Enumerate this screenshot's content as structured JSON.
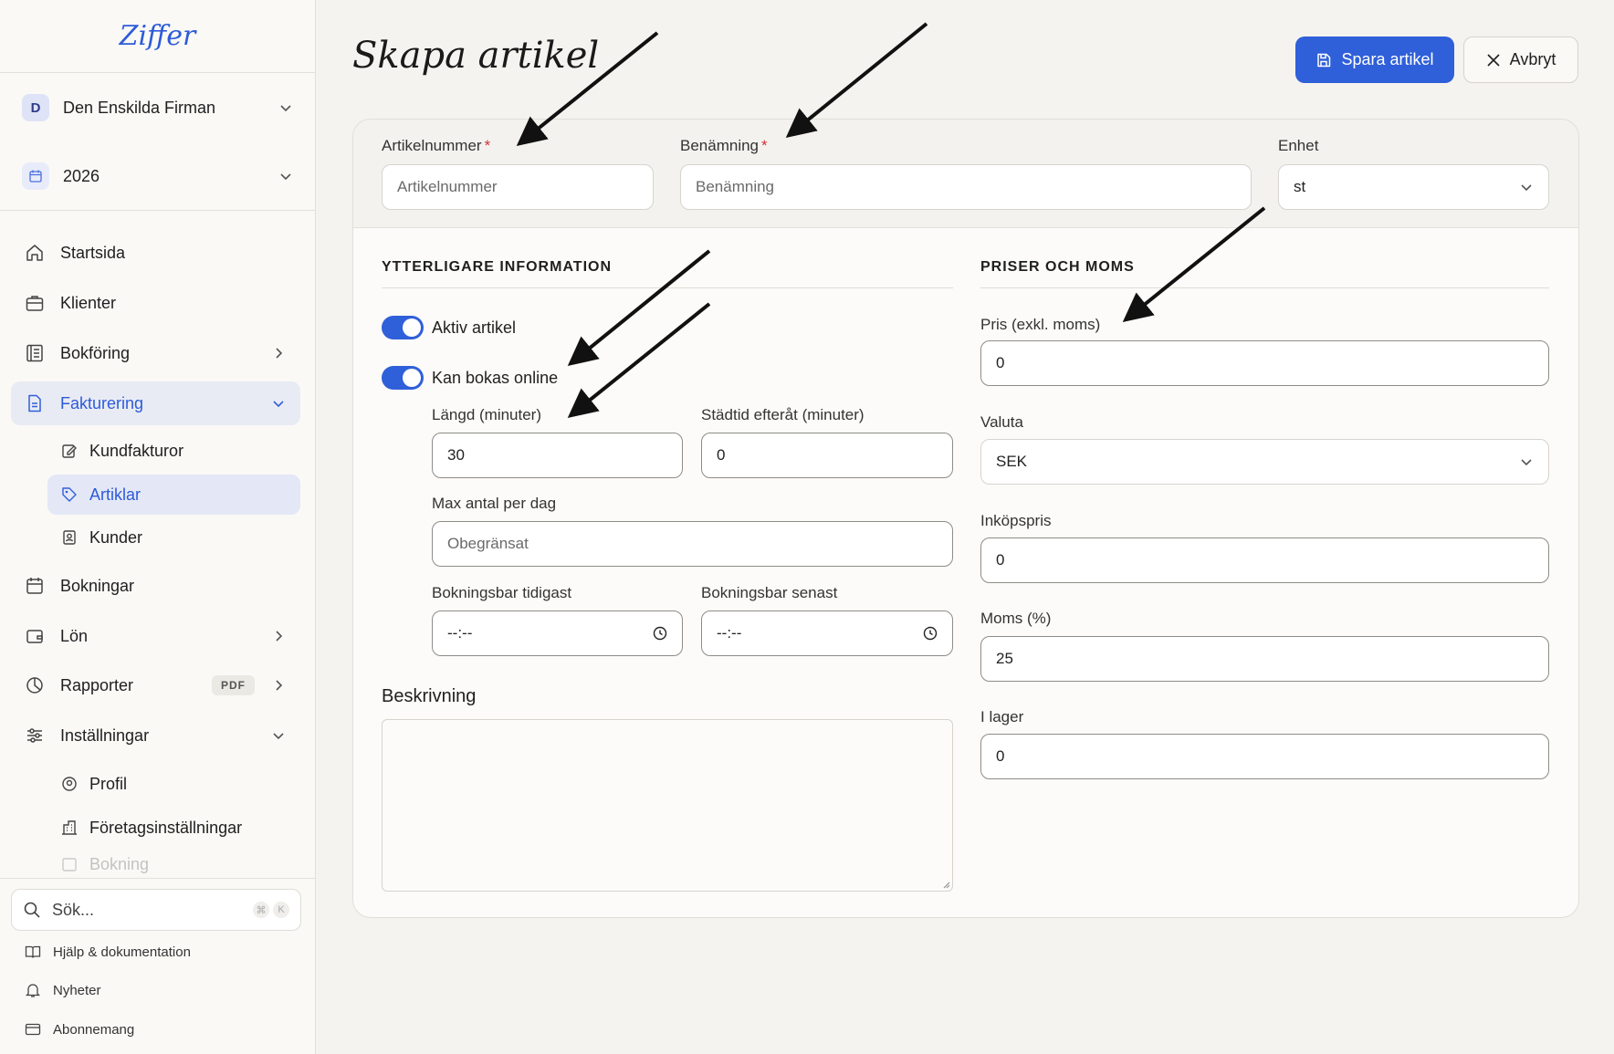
{
  "app": {
    "logo": "Ziffer"
  },
  "sidebar": {
    "company": {
      "initial": "D",
      "name": "Den Enskilda Firman"
    },
    "year": "2026",
    "items": [
      {
        "label": "Startsida"
      },
      {
        "label": "Klienter"
      },
      {
        "label": "Bokföring"
      },
      {
        "label": "Fakturering"
      },
      {
        "label": "Kundfakturor"
      },
      {
        "label": "Artiklar"
      },
      {
        "label": "Kunder"
      },
      {
        "label": "Bokningar"
      },
      {
        "label": "Lön"
      },
      {
        "label": "Rapporter",
        "badge": "PDF"
      },
      {
        "label": "Inställningar"
      },
      {
        "label": "Profil"
      },
      {
        "label": "Företagsinställningar"
      },
      {
        "label": "Bokning"
      }
    ],
    "search": {
      "placeholder": "Sök...",
      "kbd1": "⌘",
      "kbd2": "K"
    },
    "footer": [
      {
        "label": "Hjälp & dokumentation"
      },
      {
        "label": "Nyheter"
      },
      {
        "label": "Abonnemang"
      }
    ]
  },
  "page": {
    "title": "Skapa artikel",
    "save_label": "Spara artikel",
    "cancel_label": "Avbryt"
  },
  "form": {
    "artikelnummer": {
      "label": "Artikelnummer",
      "placeholder": "Artikelnummer",
      "required": "*"
    },
    "benamning": {
      "label": "Benämning",
      "placeholder": "Benämning",
      "required": "*"
    },
    "enhet": {
      "label": "Enhet",
      "value": "st"
    },
    "extra": {
      "heading": "YTTERLIGARE INFORMATION",
      "aktiv": "Aktiv artikel",
      "online": "Kan bokas online",
      "langd": {
        "label": "Längd (minuter)",
        "value": "30"
      },
      "stadtid": {
        "label": "Städtid efteråt (minuter)",
        "value": "0"
      },
      "max": {
        "label": "Max antal per dag",
        "placeholder": "Obegränsat"
      },
      "tidigast": {
        "label": "Bokningsbar tidigast",
        "value": "--:--"
      },
      "senast": {
        "label": "Bokningsbar senast",
        "value": "--:--"
      },
      "beskrivning": "Beskrivning"
    },
    "prices": {
      "heading": "PRISER OCH MOMS",
      "pris": {
        "label": "Pris (exkl. moms)",
        "value": "0"
      },
      "valuta": {
        "label": "Valuta",
        "value": "SEK"
      },
      "inkopspris": {
        "label": "Inköpspris",
        "value": "0"
      },
      "moms": {
        "label": "Moms (%)",
        "value": "25"
      },
      "lager": {
        "label": "I lager",
        "value": "0"
      }
    }
  },
  "colors": {
    "accent": "#2f5fd9",
    "background": "#f5f3ef",
    "required": "#d0343a"
  }
}
